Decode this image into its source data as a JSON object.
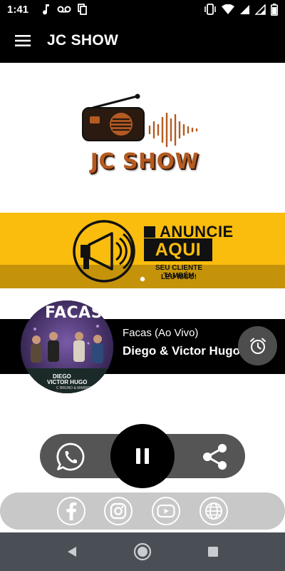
{
  "status_bar": {
    "time": "1:41",
    "icons_left": [
      "music-note-icon",
      "voicemail-icon",
      "copy-icon"
    ],
    "icons_right": [
      "vibrate-icon",
      "wifi-icon",
      "signal-icon",
      "signal-icon",
      "battery-icon"
    ]
  },
  "app_bar": {
    "title": "JC SHOW",
    "menu_icon": "hamburger-menu-icon"
  },
  "logo": {
    "text": "JC SHOW",
    "brand_color": "#b45b22"
  },
  "banner": {
    "headline": "ANUNCIE",
    "highlight": "AQUI",
    "tagline_line1": "SEU CLIENTE TAMBÉM",
    "tagline_line2": "LEU ISSO!",
    "background": "#fbbd0d",
    "carousel_pages": 1,
    "carousel_current": 1
  },
  "now_playing": {
    "cover": {
      "title": "FACAS",
      "artist_line1": "DIEGO",
      "artist_line2": "VICTOR HUGO",
      "featuring": "C BRUNO & MARRONE"
    },
    "track_title": "Facas (Ao Vivo)",
    "artist": "Diego & Victor Hugo",
    "alarm_icon": "alarm-clock-icon"
  },
  "controls": {
    "left_icon": "whatsapp-icon",
    "center_icon": "pause-icon",
    "right_icon": "share-icon"
  },
  "socials": [
    "facebook-icon",
    "instagram-icon",
    "youtube-icon",
    "globe-icon"
  ],
  "nav_bar": {
    "buttons": [
      "back-icon",
      "home-icon",
      "recents-icon"
    ]
  },
  "colors": {
    "bar_black": "#000000",
    "control_pill": "#555555",
    "social_pill": "#c8c8c8",
    "nav_bar": "#4a4f56"
  }
}
